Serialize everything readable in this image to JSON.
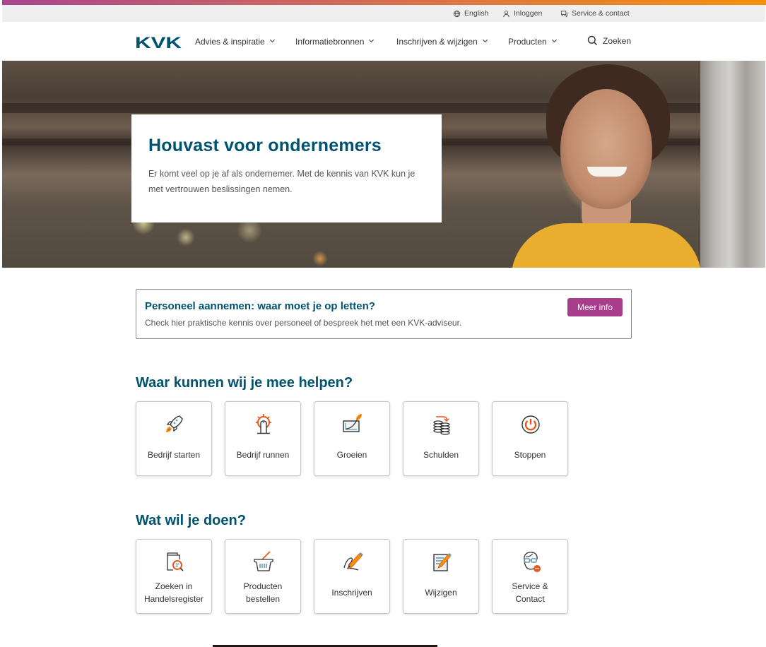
{
  "utility_bar": {
    "items": [
      {
        "label": "English",
        "icon": "globe-icon"
      },
      {
        "label": "Inloggen",
        "icon": "user-icon"
      },
      {
        "label": "Service & contact",
        "icon": "chat-icon"
      }
    ]
  },
  "nav": {
    "logo": "KVK",
    "items": [
      {
        "label": "Advies & inspiratie"
      },
      {
        "label": "Informatiebronnen"
      },
      {
        "label": "Inschrijven & wijzigen"
      },
      {
        "label": "Producten"
      }
    ],
    "search_label": "Zoeken"
  },
  "hero": {
    "title": "Houvast voor ondernemers",
    "text": "Er komt veel op je af als ondernemer. Met de kennis van KVK kun je met vertrouwen beslissingen nemen."
  },
  "promo": {
    "title": "Personeel aannemen: waar moet je op letten?",
    "text": "Check hier praktische kennis over personeel of bespreek het met een KVK-adviseur.",
    "button": "Meer info"
  },
  "help_section": {
    "title": "Waar kunnen wij je mee helpen?",
    "tiles": [
      {
        "label": "Bedrijf starten",
        "icon": "rocket-icon"
      },
      {
        "label": "Bedrijf runnen",
        "icon": "ship-wheel-icon"
      },
      {
        "label": "Groeien",
        "icon": "growth-chart-icon"
      },
      {
        "label": "Schulden",
        "icon": "coins-icon"
      },
      {
        "label": "Stoppen",
        "icon": "power-icon"
      }
    ]
  },
  "actions_section": {
    "title": "Wat wil je doen?",
    "tiles": [
      {
        "label1": "Zoeken in",
        "label2": "Handelsregister",
        "icon": "register-search-icon"
      },
      {
        "label1": "Producten",
        "label2": "bestellen",
        "icon": "basket-icon"
      },
      {
        "label1": "Inschrijven",
        "label2": "",
        "icon": "sign-pen-icon"
      },
      {
        "label1": "Wijzigen",
        "label2": "",
        "icon": "edit-document-icon"
      },
      {
        "label1": "Service &",
        "label2": "Contact",
        "icon": "advisor-icon"
      }
    ]
  },
  "colors": {
    "brand_blue": "#00526e",
    "accent_purple": "#a73d8b",
    "accent_orange": "#e8571e"
  }
}
